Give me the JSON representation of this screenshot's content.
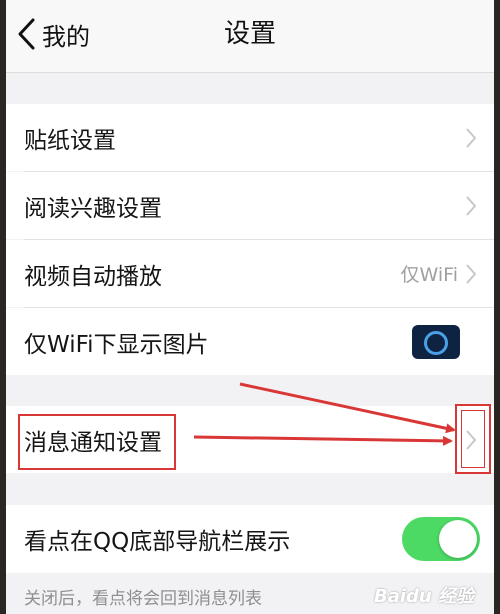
{
  "nav": {
    "back_label": "我的",
    "title": "设置"
  },
  "rows": [
    {
      "label": "贴纸设置",
      "control": "chevron"
    },
    {
      "label": "阅读兴趣设置",
      "control": "chevron"
    },
    {
      "label": "视频自动播放",
      "value": "仅WiFi",
      "control": "chevron"
    },
    {
      "label": "仅WiFi下显示图片",
      "control": "toggle",
      "state": "on"
    },
    {
      "label": "消息通知设置",
      "control": "chevron",
      "highlighted": true
    },
    {
      "label": "看点在QQ底部导航栏展示",
      "control": "toggle",
      "state": "on"
    }
  ],
  "footnote": "关闭后，看点将会回到消息列表",
  "watermark": "Baidu 经验",
  "colors": {
    "toggle_on": "#4cd964",
    "annotation": "#d93636"
  }
}
